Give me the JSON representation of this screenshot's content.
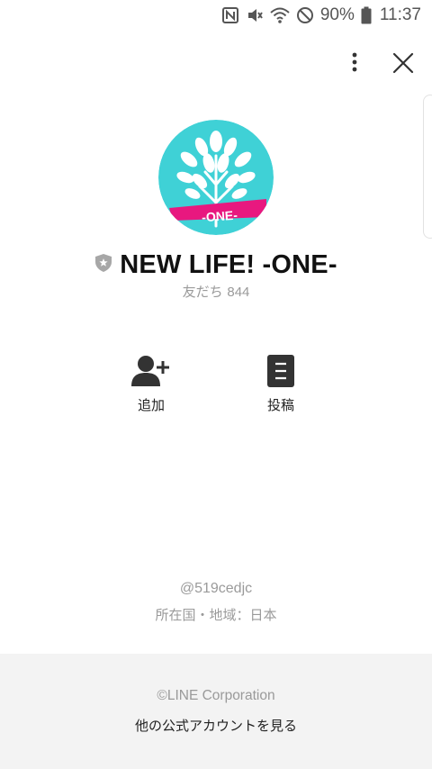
{
  "status_bar": {
    "battery_text": "90%",
    "clock": "11:37"
  },
  "profile": {
    "logo_text": "-ONE-",
    "account_name": "NEW LIFE! -ONE-",
    "friends_label": "友だち",
    "friends_count": "844",
    "avatar_color": "#3fd1d6",
    "banner_color": "#e8187f"
  },
  "actions": {
    "add_label": "追加",
    "posts_label": "投稿"
  },
  "meta": {
    "line_id": "@519cedjc",
    "region": "所在国・地域：日本"
  },
  "footer": {
    "copyright": "©LINE Corporation",
    "other_accounts": "他の公式アカウントを見る"
  }
}
